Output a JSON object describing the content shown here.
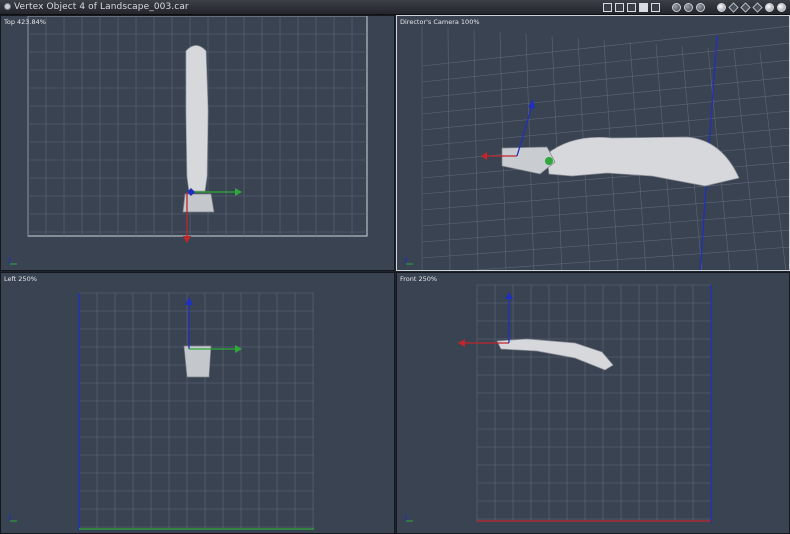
{
  "window": {
    "title": "Vertex Object 4 of Landscape_003.car",
    "toolbar_icons": [
      "layout-single-icon",
      "layout-two-icon",
      "layout-three-icon",
      "layout-four-icon",
      "layout-alt-icon",
      "camera-icon",
      "hand-icon",
      "shield-icon",
      "sphere-icon",
      "cube-icon",
      "cube-icon",
      "cube-icon",
      "render-sphere-icon",
      "render-sphere-icon"
    ]
  },
  "viewports": {
    "top": {
      "label": "Top 423.84%"
    },
    "camera": {
      "label": "Director's Camera 100%"
    },
    "left": {
      "label": "Left 250%"
    },
    "front": {
      "label": "Front 250%"
    }
  },
  "colors": {
    "background": "#3a4352",
    "grid": "#6b7384",
    "axis_x": "#c0262b",
    "axis_y": "#2fa83a",
    "axis_z": "#1f2fbf",
    "mesh": "#d8dadd"
  }
}
